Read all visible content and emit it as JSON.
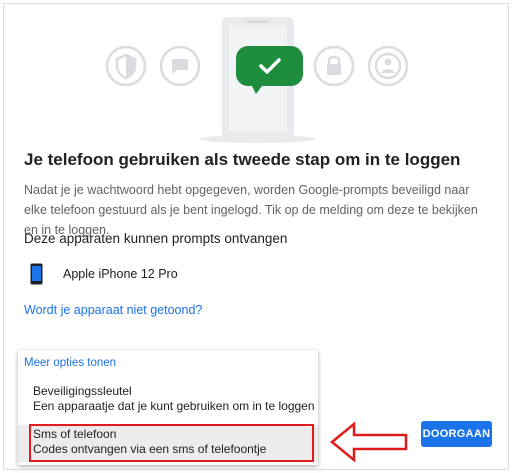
{
  "page": {
    "title": "Je telefoon gebruiken als tweede stap om in te loggen",
    "description": "Nadat je je wachtwoord hebt opgegeven, worden Google-prompts beveiligd naar elke telefoon gestuurd als je bent ingelogd. Tik op de melding om deze te bekijken en in te loggen.",
    "devices_heading": "Deze apparaten kunnen prompts ontvangen",
    "missing_device_link": "Wordt je apparaat niet getoond?"
  },
  "devices": [
    {
      "name": "Apple iPhone 12 Pro",
      "icon": "smartphone-icon"
    }
  ],
  "options_menu": {
    "toggle_label": "Meer opties tonen",
    "items": [
      {
        "title": "Beveiligingssleutel",
        "subtitle": "Een apparaatje dat je kunt gebruiken om in te loggen"
      },
      {
        "title": "Sms of telefoon",
        "subtitle": "Codes ontvangen via een sms of telefoontje",
        "highlighted": true
      }
    ]
  },
  "actions": {
    "continue_label": "DOORGAAN"
  },
  "colors": {
    "accent": "#1a73e8",
    "illustration_green": "#1e8e3e",
    "annotation_red": "#e01b1b",
    "icon_gray": "#dadce0"
  }
}
